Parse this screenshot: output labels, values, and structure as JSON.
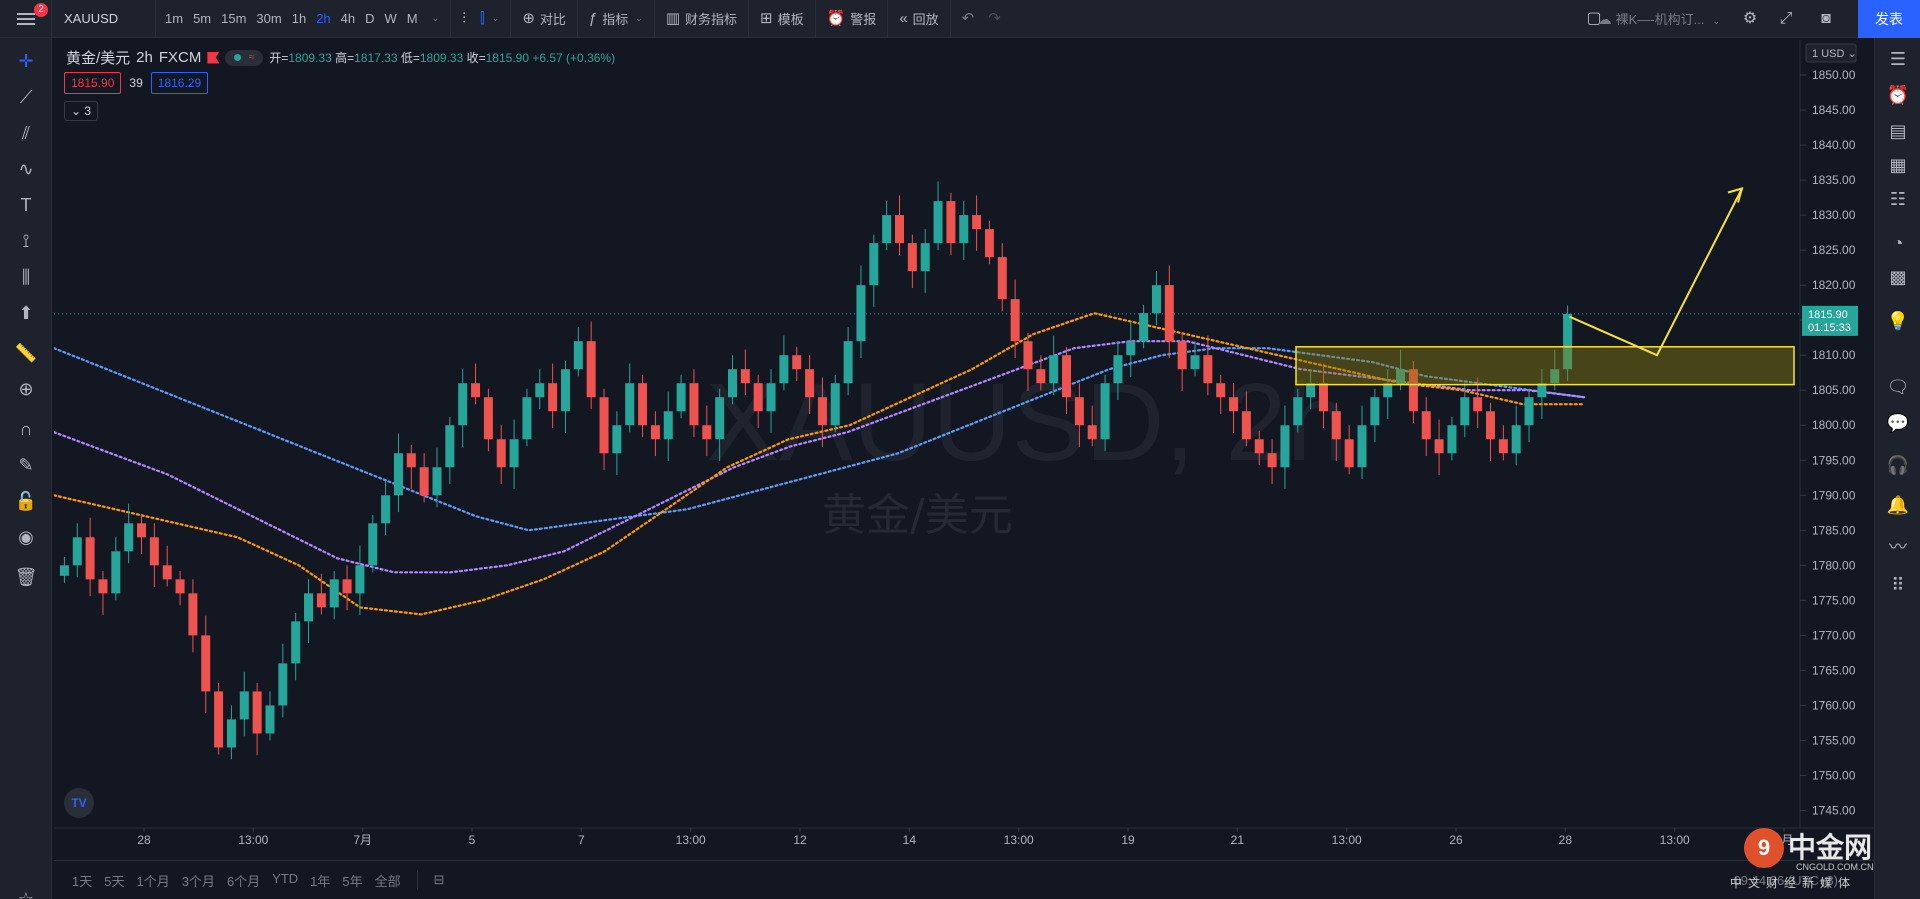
{
  "topbar": {
    "notif_count": "2",
    "symbol": "XAUUSD",
    "timeframes": [
      "1m",
      "5m",
      "15m",
      "30m",
      "1h",
      "2h",
      "4h",
      "D",
      "W",
      "M"
    ],
    "active_timeframe": "2h",
    "compare_label": "对比",
    "indicators_label": "指标",
    "financials_label": "财务指标",
    "templates_label": "模板",
    "alert_label": "警报",
    "replay_label": "回放",
    "layout_name": "裸K—-机构订...",
    "publish_label": "发表"
  },
  "legend": {
    "title": "黄金/美元",
    "interval": "2h",
    "source": "FXCM",
    "open_label": "开=",
    "open": "1809.33",
    "high_label": "高=",
    "high": "1817.33",
    "low_label": "低=",
    "low": "1809.33",
    "close_label": "收=",
    "close": "1815.90",
    "change": "+6.57 (+0.36%)",
    "sell_price": "1815.90",
    "spread": "39",
    "buy_price": "1816.29",
    "collapse_count": "3"
  },
  "chart_data": {
    "type": "candlestick",
    "symbol": "XAUUSD",
    "watermark": "XAUUSD, 2h",
    "watermark_sub": "黄金/美元",
    "currency": "USD",
    "y_ticks": [
      1850,
      1845,
      1840,
      1835,
      1830,
      1825,
      1820,
      1815,
      1810,
      1805,
      1800,
      1795,
      1790,
      1785,
      1780,
      1775,
      1770,
      1765,
      1760,
      1755,
      1750,
      1745
    ],
    "y_tick_labels": [
      "1850.00",
      "1845.00",
      "1840.00",
      "1835.00",
      "1830.00",
      "1825.00",
      "1820.00",
      "1815.00",
      "1810.00",
      "1805.00",
      "1800.00",
      "1795.00",
      "1790.00",
      "1785.00",
      "1780.00",
      "1775.00",
      "1770.00",
      "1765.00",
      "1760.00",
      "1755.00",
      "1750.00",
      "1745.00"
    ],
    "ylim": [
      1742.5,
      1855
    ],
    "x_labels": [
      "28",
      "13:00",
      "7月",
      "5",
      "7",
      "13:00",
      "12",
      "14",
      "13:00",
      "19",
      "21",
      "13:00",
      "26",
      "28",
      "13:00",
      "8月"
    ],
    "last_price": "1815.90",
    "countdown": "01:15:33",
    "close_path": [
      1780,
      1784,
      1778,
      1776,
      1782,
      1786,
      1784,
      1780,
      1778,
      1776,
      1770,
      1762,
      1754,
      1758,
      1762,
      1756,
      1760,
      1766,
      1772,
      1776,
      1774,
      1778,
      1776,
      1780,
      1786,
      1790,
      1796,
      1794,
      1790,
      1794,
      1800,
      1806,
      1804,
      1798,
      1794,
      1798,
      1804,
      1806,
      1802,
      1808,
      1812,
      1804,
      1796,
      1800,
      1806,
      1800,
      1798,
      1802,
      1806,
      1800,
      1798,
      1804,
      1808,
      1806,
      1802,
      1806,
      1810,
      1808,
      1804,
      1800,
      1806,
      1812,
      1820,
      1826,
      1830,
      1826,
      1822,
      1826,
      1832,
      1826,
      1830,
      1828,
      1824,
      1818,
      1812,
      1808,
      1806,
      1810,
      1804,
      1800,
      1798,
      1806,
      1810,
      1812,
      1816,
      1820,
      1812,
      1808,
      1810,
      1806,
      1804,
      1802,
      1798,
      1796,
      1794,
      1800,
      1804,
      1806,
      1802,
      1798,
      1794,
      1800,
      1804,
      1806,
      1808,
      1802,
      1798,
      1796,
      1800,
      1804,
      1802,
      1798,
      1796,
      1800,
      1804,
      1806,
      1808,
      1815.9
    ],
    "ma_series": [
      {
        "color": "#5b9cf6",
        "points": [
          1811,
          1808,
          1805,
          1802,
          1799,
          1796,
          1793,
          1790,
          1787,
          1785,
          1786,
          1787,
          1788,
          1790,
          1792,
          1794,
          1796,
          1799,
          1802,
          1805,
          1808,
          1810,
          1811,
          1811,
          1810,
          1809,
          1807,
          1806,
          1805,
          1804
        ]
      },
      {
        "color": "#b388ff",
        "points": [
          1799,
          1796,
          1793,
          1789,
          1785,
          1781,
          1779,
          1779,
          1780,
          1782,
          1786,
          1790,
          1794,
          1797,
          1799,
          1802,
          1805,
          1808,
          1811,
          1812,
          1812,
          1810,
          1808,
          1807,
          1806,
          1805,
          1805,
          1804
        ]
      },
      {
        "color": "#ff9800",
        "points": [
          1790,
          1788,
          1786,
          1784,
          1780,
          1774,
          1773,
          1775,
          1778,
          1782,
          1788,
          1794,
          1798,
          1800,
          1804,
          1808,
          1813,
          1816,
          1814,
          1812,
          1810,
          1808,
          1806,
          1805,
          1803,
          1803
        ]
      }
    ],
    "zone": {
      "top": 1811.2,
      "bottom": 1805.8,
      "color": "#f5e33a"
    },
    "projection": {
      "color": "#f5e33a"
    }
  },
  "bottombar": {
    "ranges": [
      "1天",
      "5天",
      "1个月",
      "3个月",
      "6个月",
      "YTD",
      "1年",
      "5年",
      "全部"
    ],
    "clock": "09:44:26 (UTC+8)"
  },
  "watermark_brand": {
    "name": "中金网",
    "url": "CNGOLD.COM.CN",
    "tagline": "中文财经新媒体"
  }
}
